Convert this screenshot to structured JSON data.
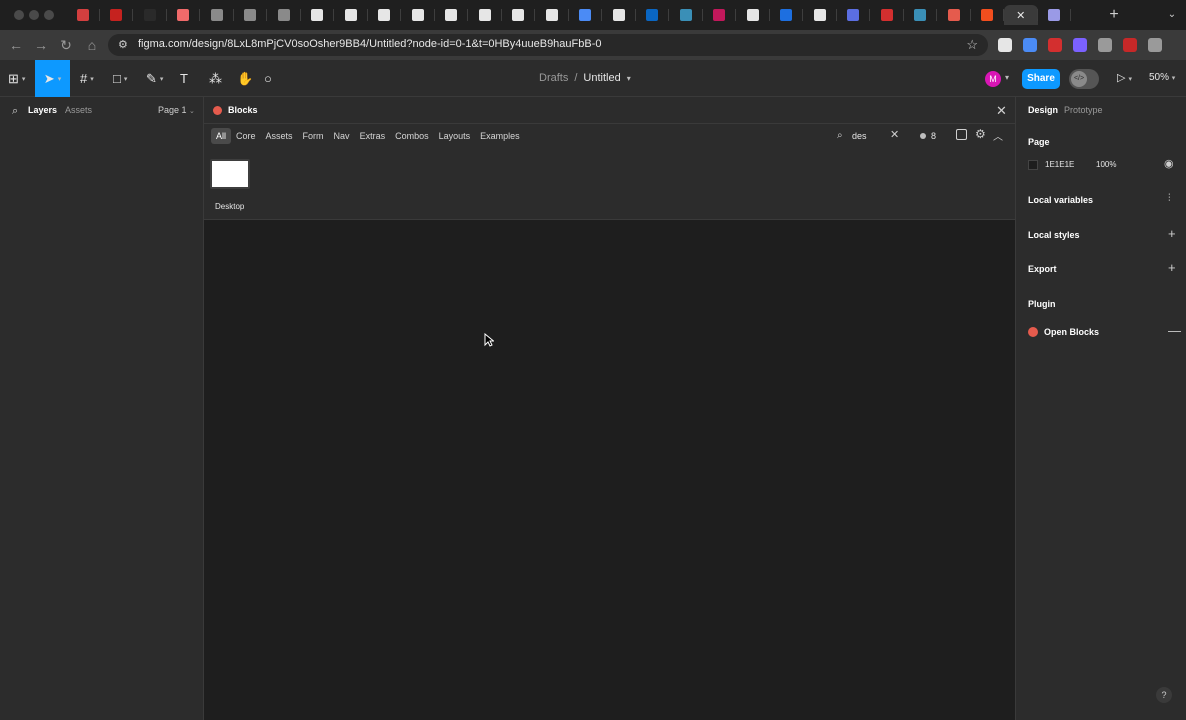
{
  "browser": {
    "tabs": [
      {
        "favicon": "globe-icon",
        "color": "#d33f3f"
      },
      {
        "favicon": "gmail-icon",
        "color": "#c5221f"
      },
      {
        "favicon": "dash-icon",
        "color": "#2a2a2a"
      },
      {
        "favicon": "asana-icon",
        "color": "#f06a6a"
      },
      {
        "favicon": "doc-icon",
        "color": "#8a8a8a"
      },
      {
        "favicon": "doc-icon",
        "color": "#8a8a8a"
      },
      {
        "favicon": "notes-icon",
        "color": "#8a8a8a"
      },
      {
        "favicon": "dark-icon",
        "color": "#e6e6e6"
      },
      {
        "favicon": "x-icon",
        "color": "#e6e6e6"
      },
      {
        "favicon": "dark-icon",
        "color": "#e6e6e6"
      },
      {
        "favicon": "dark-icon",
        "color": "#e6e6e6"
      },
      {
        "favicon": "dark-icon",
        "color": "#e6e6e6"
      },
      {
        "favicon": "dark-icon",
        "color": "#e6e6e6"
      },
      {
        "favicon": "notion-icon",
        "color": "#e6e6e6"
      },
      {
        "favicon": "notion-icon",
        "color": "#e6e6e6"
      },
      {
        "favicon": "translate-icon",
        "color": "#4b8bf5"
      },
      {
        "favicon": "chrome-icon",
        "color": "#e6e6e6"
      },
      {
        "favicon": "linkedin-icon",
        "color": "#0a66c2"
      },
      {
        "favicon": "image-icon",
        "color": "#3a8fb7"
      },
      {
        "favicon": "chart-icon",
        "color": "#c2185b"
      },
      {
        "favicon": "c-icon",
        "color": "#e6e6e6"
      },
      {
        "favicon": "app-icon",
        "color": "#1d6fe0"
      },
      {
        "favicon": "openai-icon",
        "color": "#e6e6e6"
      },
      {
        "favicon": "circle-icon",
        "color": "#5b6ee1"
      },
      {
        "favicon": "h-icon",
        "color": "#d32f2f"
      },
      {
        "favicon": "image-icon",
        "color": "#3a8fb7"
      },
      {
        "favicon": "blocks-icon",
        "color": "#e55b4d"
      },
      {
        "favicon": "figma-icon",
        "color": "#f24e1e"
      },
      {
        "favicon": "close-icon",
        "color": "#e8e8e8",
        "active": true
      },
      {
        "favicon": "monogram-icon",
        "color": "#9a9ae6"
      }
    ],
    "new_tab_glyph": "+",
    "tab_list_glyph": "⌄",
    "url": "figma.com/design/8LxL8mPjCV0soOsher9BB4/Untitled?node-id=0-1&t=0HBy4uueB9hauFbB-0",
    "extensions": [
      {
        "name": "fx-icon",
        "color": "#e6e6e6"
      },
      {
        "name": "translate-icon",
        "color": "#4b8bf5"
      },
      {
        "name": "shield-icon",
        "color": "#d32f2f"
      },
      {
        "name": "color-icon",
        "color": "#7b61ff"
      },
      {
        "name": "puzzle-icon",
        "color": "#9a9a9a"
      },
      {
        "name": "profile-icon",
        "color": "#c62828"
      },
      {
        "name": "menu-icon",
        "color": "#9a9a9a"
      }
    ]
  },
  "figma": {
    "breadcrumb": {
      "project": "Drafts",
      "separator": "/",
      "file": "Untitled"
    },
    "avatar_initial": "M",
    "share_label": "Share",
    "zoom": "50%",
    "tools": [
      {
        "name": "main-menu",
        "glyph": "⊞"
      },
      {
        "name": "move-tool",
        "glyph": "➤",
        "active": true
      },
      {
        "name": "frame-tool",
        "glyph": "#"
      },
      {
        "name": "shape-tool",
        "glyph": "□"
      },
      {
        "name": "pen-tool",
        "glyph": "✎"
      },
      {
        "name": "text-tool",
        "glyph": "T"
      },
      {
        "name": "resources-tool",
        "glyph": "⁂"
      },
      {
        "name": "hand-tool",
        "glyph": "✋"
      },
      {
        "name": "comment-tool",
        "glyph": "○"
      }
    ],
    "left_panel": {
      "tab_layers": "Layers",
      "tab_assets": "Assets",
      "page": "Page 1"
    },
    "plugin": {
      "title": "Blocks",
      "tabs": [
        "All",
        "Core",
        "Assets",
        "Form",
        "Nav",
        "Extras",
        "Combos",
        "Layouts",
        "Examples"
      ],
      "selected_tab": "All",
      "search_query": "des",
      "result_count": "8",
      "result_label": "Desktop"
    },
    "right_panel": {
      "tab_design": "Design",
      "tab_prototype": "Prototype",
      "page_heading": "Page",
      "page_color": "1E1E1E",
      "page_opacity": "100%",
      "local_variables": "Local variables",
      "local_styles": "Local styles",
      "export": "Export",
      "plugin_heading": "Plugin",
      "plugin_name": "Open Blocks",
      "help": "?"
    }
  },
  "colors": {
    "accent": "#0d99ff",
    "panel": "#2c2c2c",
    "canvas": "#1e1e1e",
    "avatar": "#d916b5"
  }
}
